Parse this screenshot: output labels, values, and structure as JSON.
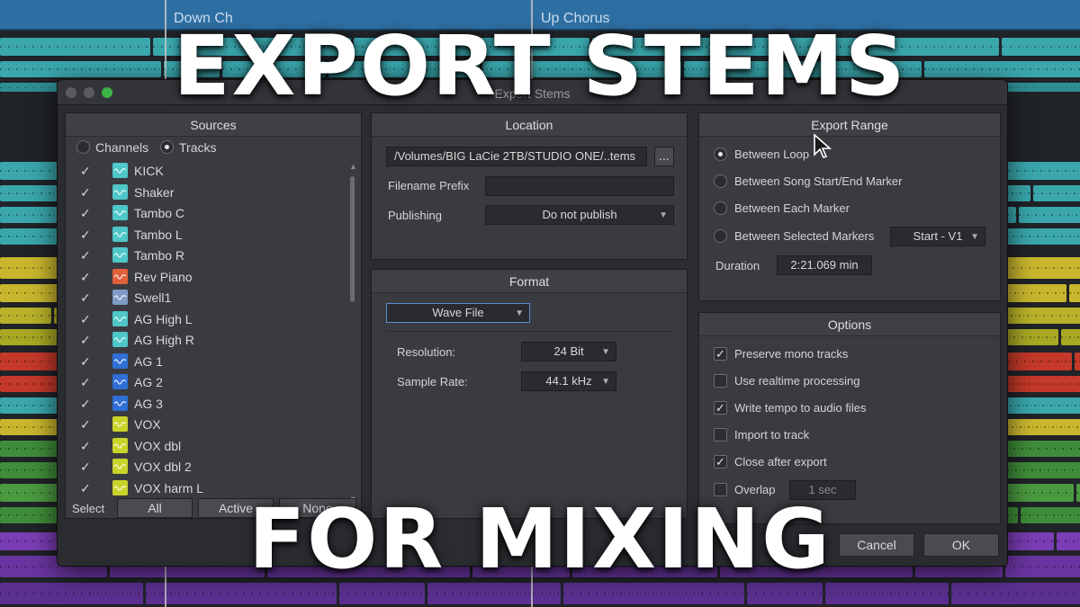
{
  "background": {
    "markers": [
      "Down Ch",
      "Up Chorus"
    ]
  },
  "overlay": {
    "line1": "EXPORT STEMS",
    "line2": "FOR MIXING"
  },
  "dialog": {
    "title": "Export Stems",
    "sources": {
      "header": "Sources",
      "mode_channels": "Channels",
      "mode_tracks": "Tracks",
      "selected_mode": "Tracks",
      "tracks": [
        {
          "name": "KICK",
          "checked": true,
          "color": "#4fc6c8",
          "icon": "audio-wave-icon"
        },
        {
          "name": "Shaker",
          "checked": true,
          "color": "#4fc6c8",
          "icon": "audio-wave-icon"
        },
        {
          "name": "Tambo C",
          "checked": true,
          "color": "#4fc6c8",
          "icon": "audio-wave-icon"
        },
        {
          "name": "Tambo L",
          "checked": true,
          "color": "#4fc6c8",
          "icon": "audio-wave-icon"
        },
        {
          "name": "Tambo R",
          "checked": true,
          "color": "#4fc6c8",
          "icon": "audio-wave-icon"
        },
        {
          "name": "Rev Piano",
          "checked": true,
          "color": "#e0603a",
          "icon": "audio-wave-icon"
        },
        {
          "name": "Swell1",
          "checked": true,
          "color": "#7f9ac4",
          "icon": "audio-wave-icon"
        },
        {
          "name": "AG High L",
          "checked": true,
          "color": "#4fc6c8",
          "icon": "audio-wave-icon"
        },
        {
          "name": "AG High R",
          "checked": true,
          "color": "#4fc6c8",
          "icon": "audio-wave-icon"
        },
        {
          "name": "AG 1",
          "checked": true,
          "color": "#2f6fd6",
          "icon": "audio-wave-icon"
        },
        {
          "name": "AG 2",
          "checked": true,
          "color": "#2f6fd6",
          "icon": "audio-wave-icon"
        },
        {
          "name": "AG 3",
          "checked": true,
          "color": "#2f6fd6",
          "icon": "audio-wave-icon"
        },
        {
          "name": "VOX",
          "checked": true,
          "color": "#c8d42a",
          "icon": "audio-wave-icon"
        },
        {
          "name": "VOX dbl",
          "checked": true,
          "color": "#c8d42a",
          "icon": "audio-wave-icon"
        },
        {
          "name": "VOX dbl 2",
          "checked": true,
          "color": "#c8d42a",
          "icon": "audio-wave-icon"
        },
        {
          "name": "VOX harm L",
          "checked": true,
          "color": "#c8d42a",
          "icon": "audio-wave-icon"
        }
      ],
      "select_label": "Select",
      "select_all": "All",
      "select_active": "Active",
      "select_none": "None"
    },
    "location": {
      "header": "Location",
      "path": "/Volumes/BIG LaCie 2TB/STUDIO ONE/..tems",
      "browse_label": "...",
      "filename_prefix_label": "Filename Prefix",
      "filename_prefix_value": "",
      "publishing_label": "Publishing",
      "publishing_value": "Do not publish"
    },
    "format": {
      "header": "Format",
      "file_type": "Wave File",
      "resolution_label": "Resolution:",
      "resolution_value": "24 Bit",
      "sample_rate_label": "Sample Rate:",
      "sample_rate_value": "44.1 kHz"
    },
    "export_range": {
      "header": "Export Range",
      "options": [
        {
          "label": "Between Loop",
          "selected": true
        },
        {
          "label": "Between Song Start/End Marker",
          "selected": false
        },
        {
          "label": "Between Each Marker",
          "selected": false
        },
        {
          "label": "Between Selected Markers",
          "selected": false
        }
      ],
      "marker_select_value": "Start - V1",
      "duration_label": "Duration",
      "duration_value": "2:21.069 min"
    },
    "options": {
      "header": "Options",
      "items": [
        {
          "label": "Preserve mono tracks",
          "checked": true
        },
        {
          "label": "Use realtime processing",
          "checked": false
        },
        {
          "label": "Write tempo to audio files",
          "checked": true
        },
        {
          "label": "Import to track",
          "checked": false
        },
        {
          "label": "Close after export",
          "checked": true
        },
        {
          "label": "Overlap",
          "checked": false
        }
      ],
      "overlap_value": "1 sec"
    },
    "buttons": {
      "cancel": "Cancel",
      "ok": "OK"
    }
  }
}
